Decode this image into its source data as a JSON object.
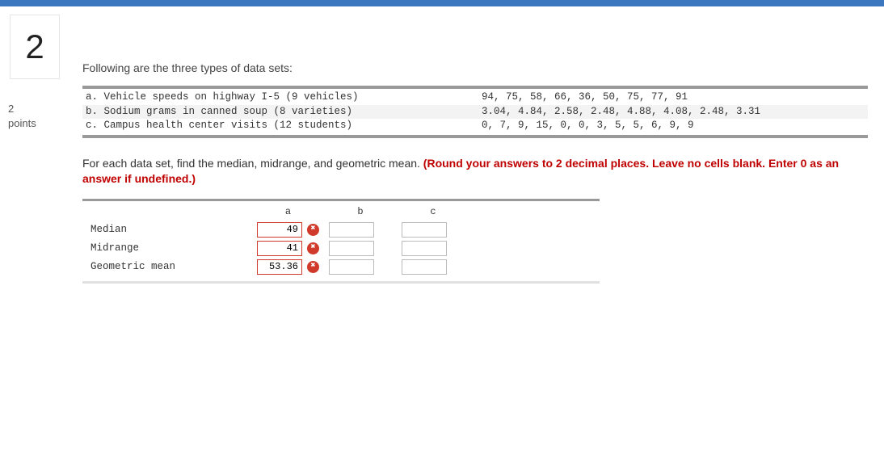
{
  "question_number": "2",
  "points_value": "2",
  "points_label": "points",
  "intro": "Following are the three types of data sets:",
  "datasets": [
    {
      "label": "a. Vehicle speeds on highway I-5 (9 vehicles)",
      "values": "94, 75, 58, 66, 36, 50, 75, 77, 91"
    },
    {
      "label": "b. Sodium grams in canned soup (8 varieties)",
      "values": "3.04, 4.84, 2.58, 2.48, 4.88, 4.08, 2.48, 3.31"
    },
    {
      "label": "c. Campus health center visits (12 students)",
      "values": "0, 7, 9, 15, 0, 0, 3, 5, 5, 6, 9, 9"
    }
  ],
  "instruction_plain": "For each data set, find the median, midrange, and geometric mean. ",
  "instruction_red": "(Round your answers to 2 decimal places. Leave no cells blank. Enter 0 as an answer if undefined.)",
  "cols": {
    "a": "a",
    "b": "b",
    "c": "c"
  },
  "rows": {
    "median": {
      "label": "Median",
      "a": "49",
      "b": "",
      "c": ""
    },
    "midrange": {
      "label": "Midrange",
      "a": "41",
      "b": "",
      "c": ""
    },
    "geomean": {
      "label": "Geometric mean",
      "a": "53.36",
      "b": "",
      "c": ""
    }
  }
}
